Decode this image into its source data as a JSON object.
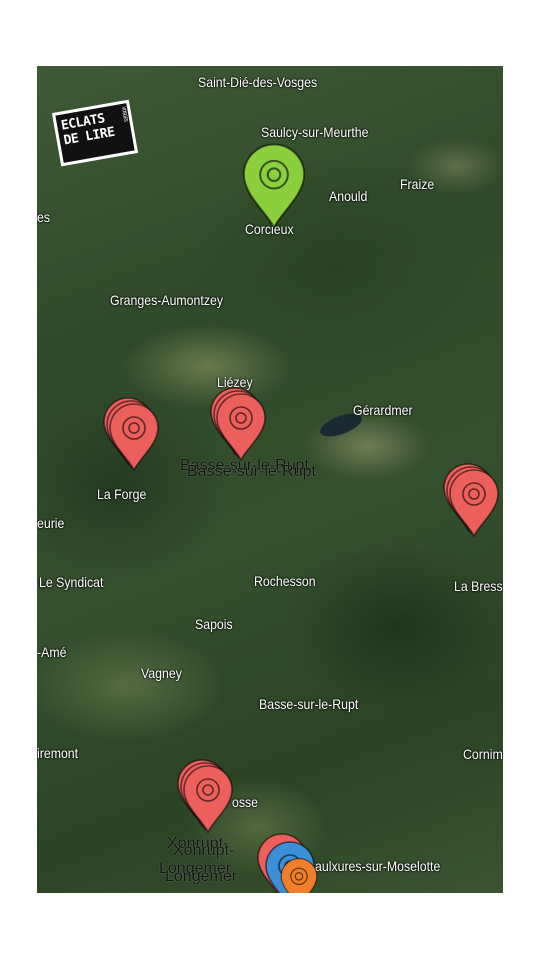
{
  "colors": {
    "red_pin": "#ec5f5c",
    "green_pin": "#8ccf3d",
    "blue_pin": "#3b8fd6",
    "orange_pin": "#ef7f2a"
  },
  "logo": {
    "line1": "ECLATS",
    "line2": "DE LIRE",
    "side": "VOSGES"
  },
  "places": [
    {
      "id": "saint-die",
      "name": "Saint-Dié-des-Vosges"
    },
    {
      "id": "saulcy",
      "name": "Saulcy-sur-Meurthe"
    },
    {
      "id": "anould",
      "name": "Anould"
    },
    {
      "id": "fraize",
      "name": "Fraize"
    },
    {
      "id": "corcieux",
      "name": "Corcieux"
    },
    {
      "id": "granges",
      "name": "Granges-Aumontzey"
    },
    {
      "id": "liezey",
      "name": "Liézey"
    },
    {
      "id": "gerardmer",
      "name": "Gérardmer"
    },
    {
      "id": "la-forge",
      "name": "La Forge"
    },
    {
      "id": "la-bresse",
      "name": "La Bress"
    },
    {
      "id": "le-syndicat",
      "name": "Le Syndicat"
    },
    {
      "id": "rochesson",
      "name": "Rochesson"
    },
    {
      "id": "sapois",
      "name": "Sapois"
    },
    {
      "id": "vagney",
      "name": "Vagney"
    },
    {
      "id": "basse-sur-le-rupt",
      "name": "Basse-sur-le-Rupt"
    },
    {
      "id": "cornim",
      "name": "Cornim"
    },
    {
      "id": "iremont",
      "name": "iremont"
    },
    {
      "id": "osse",
      "name": "osse"
    },
    {
      "id": "saulxures",
      "name": "aulxures-sur-Moselotte"
    },
    {
      "id": "es",
      "name": "es"
    },
    {
      "id": "eurie",
      "name": "eurie"
    },
    {
      "id": "ame",
      "name": "-Amé"
    }
  ],
  "markers": [
    {
      "id": "green",
      "color": "green",
      "label": ""
    },
    {
      "id": "la-forge",
      "color": "red",
      "stack": 3,
      "label": ""
    },
    {
      "id": "basse",
      "color": "red",
      "stack": 3,
      "label": "Basse-sur-le-Rupt"
    },
    {
      "id": "la-bresse",
      "color": "red",
      "stack": 3,
      "label": ""
    },
    {
      "id": "xonrupt",
      "color": "red",
      "stack": 3,
      "label": "Xonrupt-"
    },
    {
      "id": "longemer",
      "color": "red",
      "label": "Longemer"
    },
    {
      "id": "longemer-blue",
      "color": "blue",
      "label": ""
    },
    {
      "id": "longemer-orange",
      "color": "orange",
      "label": ""
    }
  ]
}
